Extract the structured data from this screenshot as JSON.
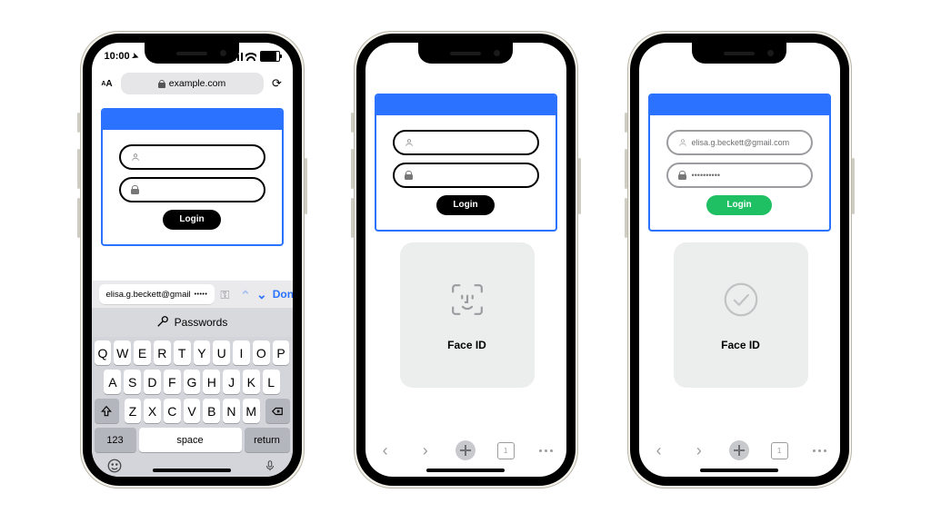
{
  "status": {
    "time": "10:00"
  },
  "url": {
    "domain": "example.com"
  },
  "login": {
    "label": "Login",
    "filled_email": "elisa.g.beckett@gmail.com",
    "filled_pw_dots": "••••••••••"
  },
  "autofill": {
    "suggestion_name": "elisa.g.beckett@gmail",
    "suggestion_pw": "•••••",
    "done": "Done",
    "passwords": "Passwords"
  },
  "keyboard": {
    "rows": [
      [
        "Q",
        "W",
        "E",
        "R",
        "T",
        "Y",
        "U",
        "I",
        "O",
        "P"
      ],
      [
        "A",
        "S",
        "D",
        "F",
        "G",
        "H",
        "J",
        "K",
        "L"
      ],
      [
        "Z",
        "X",
        "C",
        "V",
        "B",
        "N",
        "M"
      ]
    ],
    "k123": "123",
    "space": "space",
    "ret": "return"
  },
  "faceid": {
    "label": "Face ID"
  },
  "tabs": {
    "count": "1"
  }
}
